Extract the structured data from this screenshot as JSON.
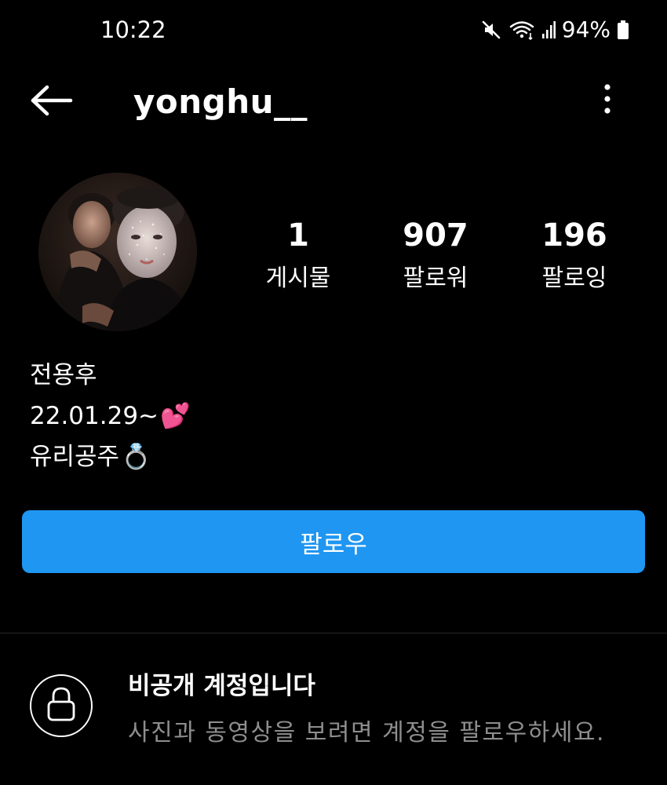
{
  "status_bar": {
    "time": "10:22",
    "battery": "94%",
    "icons": [
      "mute-icon",
      "wifi-icon",
      "signal-icon",
      "battery-icon"
    ]
  },
  "header": {
    "username": "yonghu__",
    "back_icon": "arrow-left-icon",
    "more_icon": "more-vertical-icon"
  },
  "stats": [
    {
      "value": "1",
      "label": "게시물"
    },
    {
      "value": "907",
      "label": "팔로워"
    },
    {
      "value": "196",
      "label": "팔로잉"
    }
  ],
  "bio": {
    "name": "전용후",
    "line2": "22.01.29~",
    "line2_emoji": "💕",
    "line3": "유리공주",
    "line3_emoji": "💍"
  },
  "follow_button": {
    "label": "팔로우",
    "color": "#1e96f2"
  },
  "private_notice": {
    "title": "비공개 계정입니다",
    "description": "사진과 동영상을 보려면 계정을 팔로우하세요.",
    "icon": "lock-icon"
  }
}
